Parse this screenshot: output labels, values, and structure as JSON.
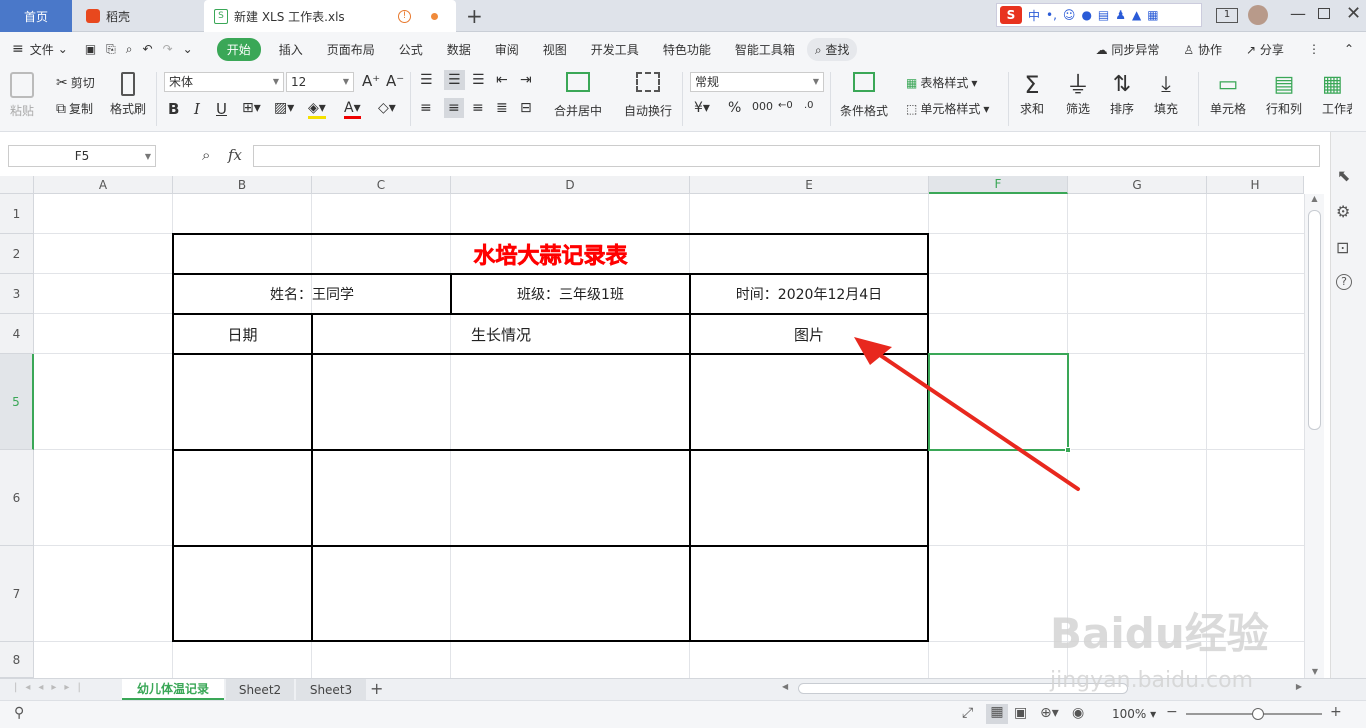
{
  "tabs": {
    "home": "首页",
    "daoke": "稻壳",
    "file": "新建 XLS 工作表.xls"
  },
  "menu": {
    "file": "文件",
    "items": [
      "开始",
      "插入",
      "页面布局",
      "公式",
      "数据",
      "审阅",
      "视图",
      "开发工具",
      "特色功能",
      "智能工具箱"
    ],
    "search": "查找",
    "sync": "同步异常",
    "collab": "协作",
    "share": "分享"
  },
  "ribbon": {
    "paste": "粘贴",
    "cut": "剪切",
    "copy": "复制",
    "format_painter": "格式刷",
    "font_name": "宋体",
    "font_size": "12",
    "merge_center": "合并居中",
    "wrap_text": "自动换行",
    "number_format": "常规",
    "cond_format": "条件格式",
    "table_style": "表格样式",
    "cell_style": "单元格样式",
    "sum": "求和",
    "filter": "筛选",
    "sort": "排序",
    "fill": "填充",
    "cell": "单元格",
    "row_col": "行和列",
    "worksheet": "工作表"
  },
  "formula_bar": {
    "name_box": "F5",
    "fx": "fx",
    "value": ""
  },
  "columns": [
    "A",
    "B",
    "C",
    "D",
    "E",
    "F",
    "G",
    "H"
  ],
  "rows": [
    "1",
    "2",
    "3",
    "4",
    "5",
    "6",
    "7",
    "8"
  ],
  "table": {
    "title": "水培大蒜记录表",
    "name": "姓名：王同学",
    "class": "班级：三年级1班",
    "time": "时间：2020年12月4日",
    "col_date": "日期",
    "col_growth": "生长情况",
    "col_picture": "图片"
  },
  "sheets": [
    "幼儿体温记录",
    "Sheet2",
    "Sheet3"
  ],
  "status": {
    "zoom": "100%"
  },
  "watermark": {
    "brand": "Baidu经验",
    "url": "jingyan.baidu.com"
  },
  "colors": {
    "accent": "#3aa757",
    "title_red": "#ff0000",
    "arrow": "#e8281e"
  }
}
